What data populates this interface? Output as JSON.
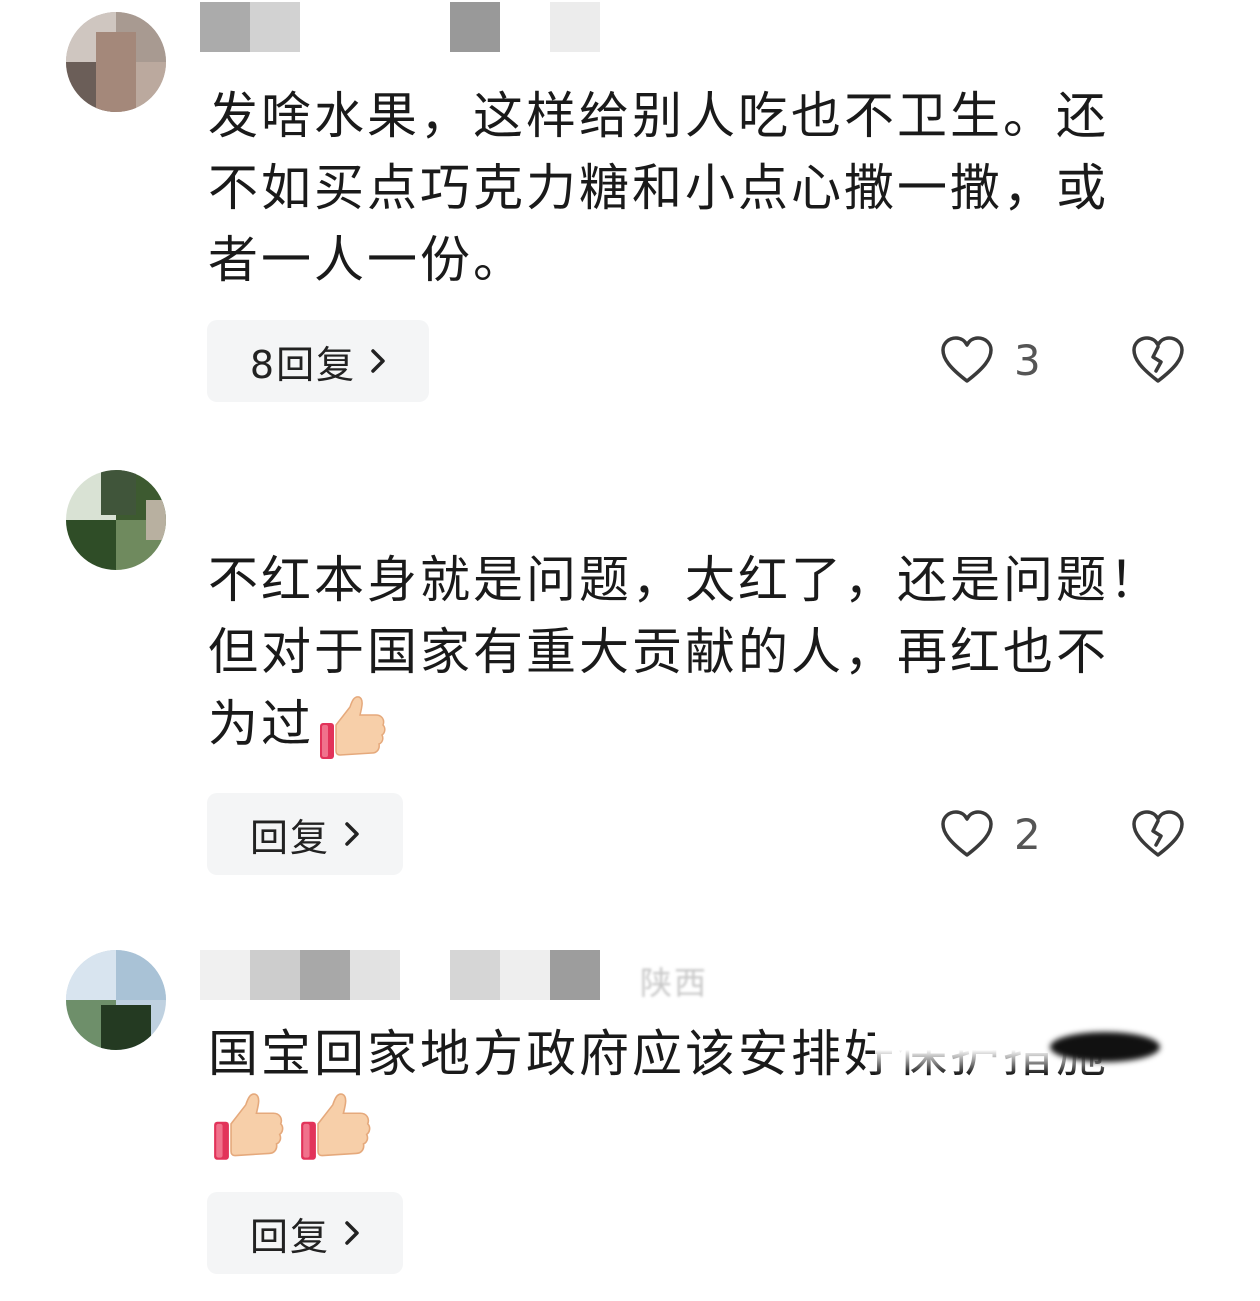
{
  "comments": [
    {
      "lines": [
        "发啥水果，这样给别人吃也不卫生。还",
        "不如买点巧克力糖和小点心撒一撒，或",
        "者一人一份。"
      ],
      "reply_label": "8回复",
      "like_count": "3"
    },
    {
      "lines": [
        "不红本身就是问题，太红了，还是问题！",
        "但对于国家有重大贡献的人，再红也不",
        "为过"
      ],
      "reply_label": "回复",
      "like_count": "2"
    },
    {
      "location": "陕西",
      "lines": [
        "国宝回家地方政府应该安排好保护措施"
      ],
      "reply_label": "回复"
    }
  ],
  "icons": {
    "reply_chevron": "chevron-right-icon",
    "like": "heart-outline-icon",
    "dislike": "broken-heart-icon",
    "emoji": "thumbs-up-icon"
  },
  "colors": {
    "reply_bg": "#f4f5f6",
    "icon_stroke": "#3a3a3a",
    "count_text": "#555555",
    "text": "#1a1a1a"
  }
}
